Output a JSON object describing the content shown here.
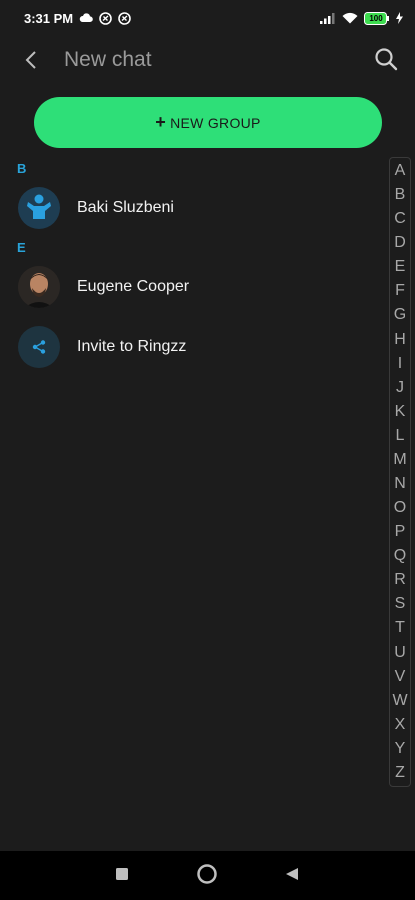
{
  "status_bar": {
    "time": "3:31 PM",
    "battery": "100"
  },
  "header": {
    "title": "New chat"
  },
  "new_group": {
    "plus": "+",
    "label": "NEW GROUP"
  },
  "sections": [
    {
      "letter": "B",
      "contacts": [
        {
          "name": "Baki Sluzbeni",
          "avatar": "blue-person-avatar"
        }
      ]
    },
    {
      "letter": "E",
      "contacts": [
        {
          "name": "Eugene Cooper",
          "avatar": "photo-avatar"
        }
      ]
    }
  ],
  "invite": {
    "label": "Invite to Ringzz",
    "icon": "share-icon"
  },
  "alphabet": [
    "A",
    "B",
    "C",
    "D",
    "E",
    "F",
    "G",
    "H",
    "I",
    "J",
    "K",
    "L",
    "M",
    "N",
    "O",
    "P",
    "Q",
    "R",
    "S",
    "T",
    "U",
    "V",
    "W",
    "X",
    "Y",
    "Z"
  ],
  "colors": {
    "accent_green": "#2edf78",
    "section_blue": "#29a3d9",
    "background": "#1c1c1c"
  }
}
